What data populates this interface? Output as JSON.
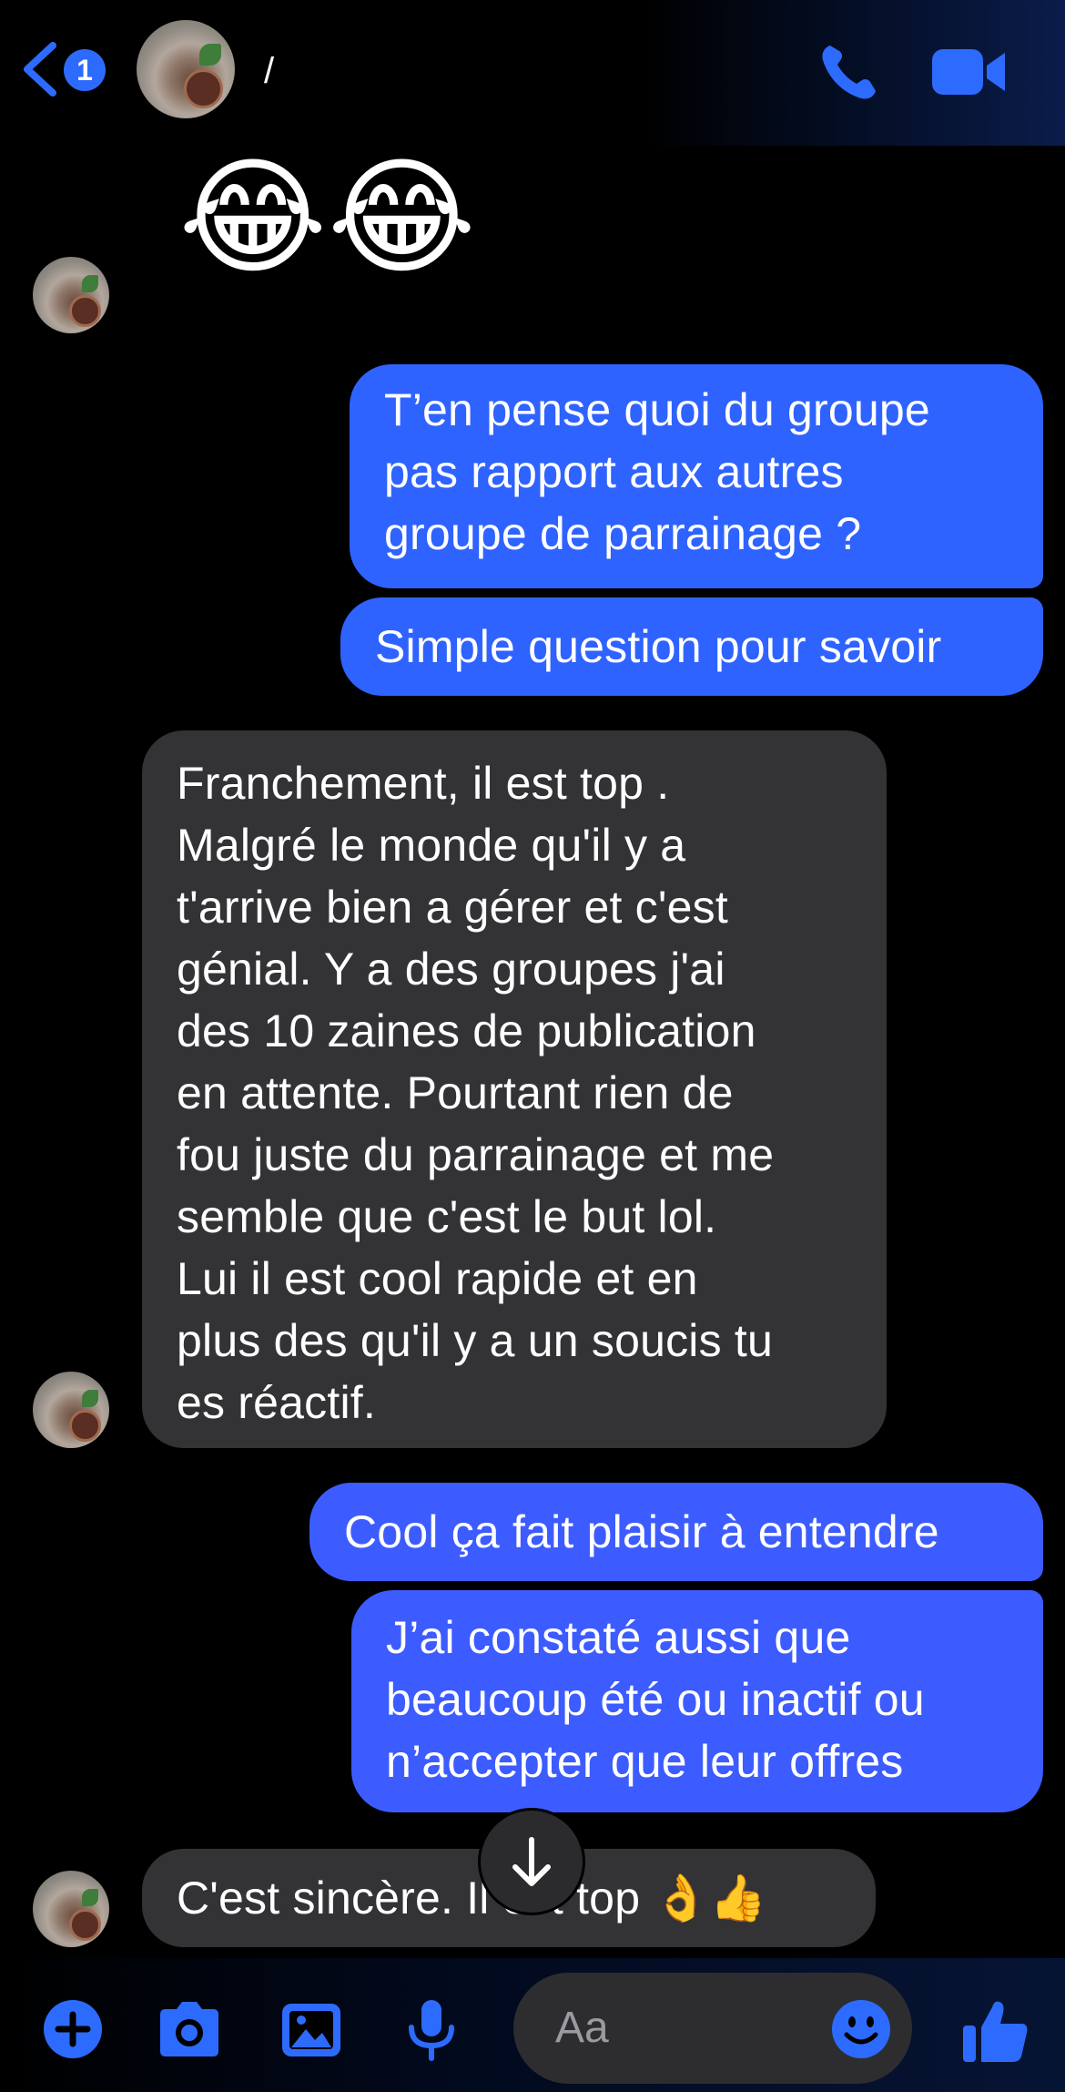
{
  "header": {
    "back_badge": "1",
    "contact_name": "/"
  },
  "icons": {
    "back": "chevron-left-icon",
    "call": "phone-icon",
    "video": "video-camera-icon",
    "scroll_down": "arrow-down-icon",
    "add": "plus-circle-icon",
    "camera": "camera-icon",
    "gallery": "image-icon",
    "mic": "microphone-icon",
    "emoji": "smiley-icon",
    "like": "thumbs-up-icon"
  },
  "colors": {
    "accent": "#2f63ff",
    "received_bubble": "#333336",
    "background": "#000000"
  },
  "messages": {
    "m0": {
      "sender": "contact",
      "text": "😂😂"
    },
    "m1": {
      "sender": "me",
      "lines": [
        "T’en pense quoi du groupe",
        "pas rapport aux autres",
        "groupe de parrainage ?"
      ]
    },
    "m2": {
      "sender": "me",
      "lines": [
        "Simple question pour savoir"
      ]
    },
    "m3": {
      "sender": "contact",
      "lines": [
        "Franchement, il est top .",
        "Malgré le monde qu'il y a",
        "t'arrive bien a gérer et c'est",
        "génial. Y a des groupes j'ai",
        "des 10 zaines de publication",
        "en attente. Pourtant rien de",
        "fou juste du parrainage et me",
        "semble que c'est le but lol.",
        "Lui il est cool rapide et en",
        "plus des qu'il y a un soucis tu",
        "es réactif."
      ]
    },
    "m4": {
      "sender": "me",
      "lines": [
        "Cool ça fait plaisir à entendre"
      ]
    },
    "m5": {
      "sender": "me",
      "lines": [
        "J’ai constaté aussi que",
        "beaucoup été ou inactif ou",
        "n’accepter que leur offres"
      ]
    },
    "m6": {
      "sender": "contact",
      "text": "C'est sincère. Il est top 👌👍",
      "visible_start": "C'est sincère.",
      "visible_end": "st top 👌👍"
    }
  },
  "composer": {
    "placeholder": "Aa"
  }
}
